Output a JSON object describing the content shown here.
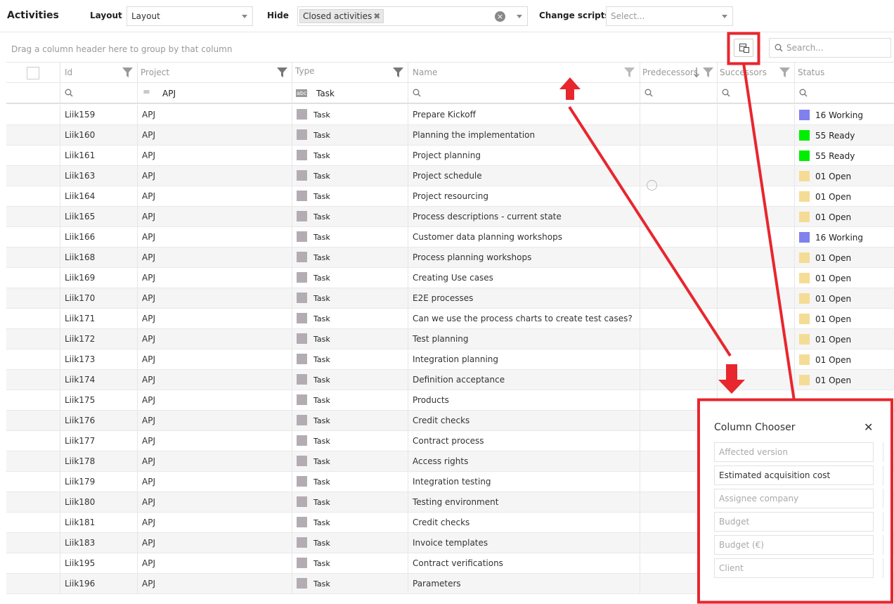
{
  "app": {
    "title": "Activities"
  },
  "toolbar": {
    "layout_label": "Layout",
    "layout_value": "Layout",
    "hide_label": "Hide",
    "hide_chip": "Closed activities",
    "scripts_label": "Change scripts",
    "scripts_placeholder": "Select..."
  },
  "grid": {
    "group_hint": "Drag a column header here to group by that column",
    "search_placeholder": "Search...",
    "columns": [
      "Id",
      "Project",
      "Type",
      "Name",
      "Predecessors",
      "Successors",
      "Status"
    ],
    "filters": {
      "project": "APJ",
      "type": "Task"
    },
    "rows": [
      {
        "id": "Liik159",
        "project": "APJ",
        "type": "Task",
        "name": "Prepare Kickoff",
        "status": "16 Working",
        "status_color": "#8080ee"
      },
      {
        "id": "Liik160",
        "project": "APJ",
        "type": "Task",
        "name": "Planning the implementation",
        "status": "55 Ready",
        "status_color": "#00ee00"
      },
      {
        "id": "Liik161",
        "project": "APJ",
        "type": "Task",
        "name": "Project planning",
        "status": "55 Ready",
        "status_color": "#00ee00"
      },
      {
        "id": "Liik163",
        "project": "APJ",
        "type": "Task",
        "name": "Project schedule",
        "status": "01 Open",
        "status_color": "#f5dc96"
      },
      {
        "id": "Liik164",
        "project": "APJ",
        "type": "Task",
        "name": "Project resourcing",
        "status": "01 Open",
        "status_color": "#f5dc96"
      },
      {
        "id": "Liik165",
        "project": "APJ",
        "type": "Task",
        "name": "Process descriptions - current state",
        "status": "01 Open",
        "status_color": "#f5dc96"
      },
      {
        "id": "Liik166",
        "project": "APJ",
        "type": "Task",
        "name": "Customer data planning workshops",
        "status": "16 Working",
        "status_color": "#8080ee"
      },
      {
        "id": "Liik168",
        "project": "APJ",
        "type": "Task",
        "name": "Process planning workshops",
        "status": "01 Open",
        "status_color": "#f5dc96"
      },
      {
        "id": "Liik169",
        "project": "APJ",
        "type": "Task",
        "name": "Creating Use cases",
        "status": "01 Open",
        "status_color": "#f5dc96"
      },
      {
        "id": "Liik170",
        "project": "APJ",
        "type": "Task",
        "name": "E2E processes",
        "status": "01 Open",
        "status_color": "#f5dc96"
      },
      {
        "id": "Liik171",
        "project": "APJ",
        "type": "Task",
        "name": "Can we use the process charts to create test cases?",
        "status": "01 Open",
        "status_color": "#f5dc96"
      },
      {
        "id": "Liik172",
        "project": "APJ",
        "type": "Task",
        "name": "Test planning",
        "status": "01 Open",
        "status_color": "#f5dc96"
      },
      {
        "id": "Liik173",
        "project": "APJ",
        "type": "Task",
        "name": "Integration planning",
        "status": "01 Open",
        "status_color": "#f5dc96"
      },
      {
        "id": "Liik174",
        "project": "APJ",
        "type": "Task",
        "name": "Definition acceptance",
        "status": "01 Open",
        "status_color": "#f5dc96"
      },
      {
        "id": "Liik175",
        "project": "APJ",
        "type": "Task",
        "name": "Products",
        "status": "",
        "status_color": ""
      },
      {
        "id": "Liik176",
        "project": "APJ",
        "type": "Task",
        "name": "Credit checks",
        "status": "",
        "status_color": ""
      },
      {
        "id": "Liik177",
        "project": "APJ",
        "type": "Task",
        "name": "Contract process",
        "status": "",
        "status_color": ""
      },
      {
        "id": "Liik178",
        "project": "APJ",
        "type": "Task",
        "name": "Access rights",
        "status": "",
        "status_color": ""
      },
      {
        "id": "Liik179",
        "project": "APJ",
        "type": "Task",
        "name": "Integration testing",
        "status": "",
        "status_color": ""
      },
      {
        "id": "Liik180",
        "project": "APJ",
        "type": "Task",
        "name": "Testing environment",
        "status": "",
        "status_color": ""
      },
      {
        "id": "Liik181",
        "project": "APJ",
        "type": "Task",
        "name": "Credit checks",
        "status": "",
        "status_color": ""
      },
      {
        "id": "Liik183",
        "project": "APJ",
        "type": "Task",
        "name": "Invoice templates",
        "status": "",
        "status_color": ""
      },
      {
        "id": "Liik195",
        "project": "APJ",
        "type": "Task",
        "name": "Contract verifications",
        "status": "",
        "status_color": ""
      },
      {
        "id": "Liik196",
        "project": "APJ",
        "type": "Task",
        "name": "Parameters",
        "status": "",
        "status_color": ""
      }
    ]
  },
  "column_chooser": {
    "title": "Column Chooser",
    "close": "✕",
    "items": [
      "Affected version",
      "Estimated acquisition cost",
      "Assignee company",
      "Budget",
      "Budget (€)",
      "Client"
    ]
  },
  "colors": {
    "annotation": "#e8262e"
  }
}
